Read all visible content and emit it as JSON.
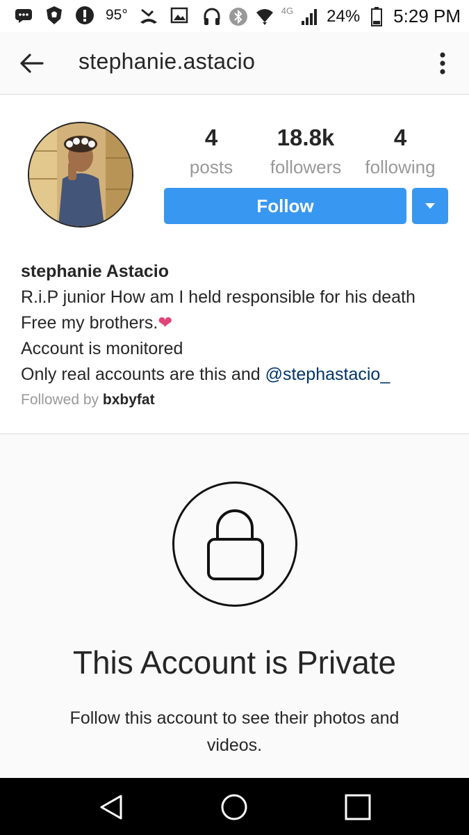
{
  "status_bar": {
    "temperature": "95°",
    "network": "4G",
    "battery": "24%",
    "time": "5:29 PM"
  },
  "header": {
    "title": "stephanie.astacio"
  },
  "profile": {
    "stats": [
      {
        "value": "4",
        "label": "posts"
      },
      {
        "value": "18.8k",
        "label": "followers"
      },
      {
        "value": "4",
        "label": "following"
      }
    ],
    "follow_label": "Follow",
    "name": "stephanie Astacio",
    "bio_line1": "R.i.P junior How am I held responsible for his death",
    "bio_line2": "Free my brothers.",
    "bio_line2_emoji": "❤",
    "bio_line3": "Account is monitored",
    "bio_line4": "Only real accounts are this and ",
    "bio_mention": "@stephastacio_",
    "followed_by_prefix": "Followed by ",
    "followed_by_user": "bxbyfat"
  },
  "private": {
    "title": "This Account is Private",
    "subtitle": "Follow this account to see their photos and videos."
  },
  "colors": {
    "accent": "#3897f0",
    "mention": "#003569",
    "heart": "#e0457b"
  },
  "icons": [
    "back-arrow-icon",
    "more-vertical-icon",
    "dropdown-caret-icon",
    "lock-icon",
    "nav-back-icon",
    "nav-home-icon",
    "nav-recents-icon"
  ]
}
